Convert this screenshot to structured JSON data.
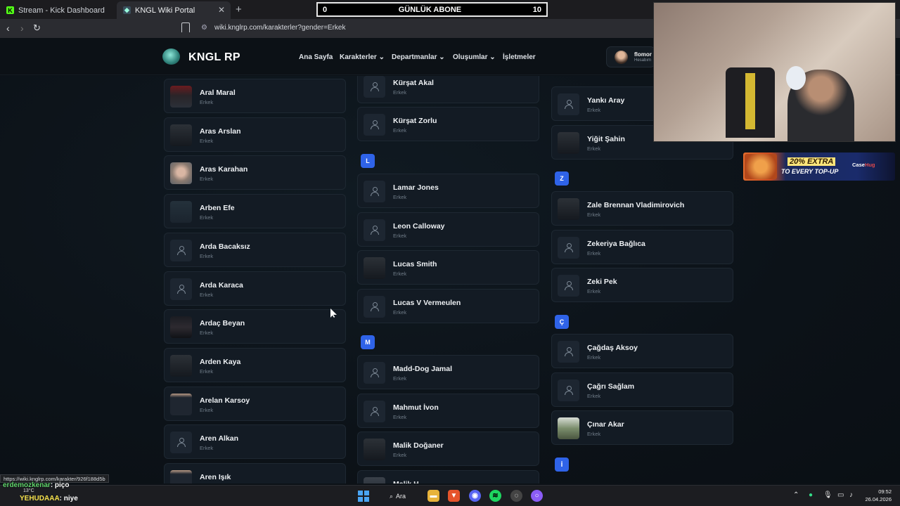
{
  "browser": {
    "tabs": [
      {
        "title": "Stream - Kick Dashboard",
        "icon": "kick-icon"
      },
      {
        "title": "KNGL Wiki Portal",
        "icon": "kngl-icon"
      }
    ],
    "url": "wiki.knglrp.com/karakterler?gender=Erkek"
  },
  "overlay": {
    "sub_label": "GÜNLÜK ABONE",
    "sub_left": "0",
    "sub_right": "10",
    "ad_title": "20% EXTRA",
    "ad_sub": "TO EVERY TOP-UP",
    "ad_brand_a": "Case",
    "ad_brand_b": "Hug"
  },
  "site": {
    "brand": "KNGL RP",
    "nav": [
      "Ana Sayfa",
      "Karakterler",
      "Departmanlar",
      "Oluşumlar",
      "İşletmeler"
    ],
    "user_name": "flomor",
    "user_sub": "Hesabım"
  },
  "gender_label": "Erkek",
  "columns": {
    "col1": [
      {
        "name": "Aral Maral",
        "avatar": "photo-red"
      },
      {
        "name": "Aras Arslan",
        "avatar": "photo-dark"
      },
      {
        "name": "Aras Karahan",
        "avatar": "photo-face"
      },
      {
        "name": "Arben Efe",
        "avatar": "photo-teal"
      },
      {
        "name": "Arda Bacaksız",
        "avatar": "default"
      },
      {
        "name": "Arda Karaca",
        "avatar": "default"
      },
      {
        "name": "Ardaç Beyan",
        "avatar": "photo-scene"
      },
      {
        "name": "Arden Kaya",
        "avatar": "photo-dark"
      },
      {
        "name": "Arelan Karsoy",
        "avatar": "photo-tan"
      },
      {
        "name": "Aren Alkan",
        "avatar": "default"
      },
      {
        "name": "Aren Işık",
        "avatar": "photo-tan"
      }
    ],
    "col2_top": [
      {
        "name": "Kürşat Akal",
        "avatar": "default"
      },
      {
        "name": "Kürşat Zorlu",
        "avatar": "default"
      }
    ],
    "col2_L_letter": "L",
    "col2_L": [
      {
        "name": "Lamar Jones",
        "avatar": "default"
      },
      {
        "name": "Leon Calloway",
        "avatar": "default"
      },
      {
        "name": "Lucas Smith",
        "avatar": "photo-dark"
      },
      {
        "name": "Lucas V Vermeulen",
        "avatar": "default"
      }
    ],
    "col2_M_letter": "M",
    "col2_M": [
      {
        "name": "Madd-Dog Jamal",
        "avatar": "default"
      },
      {
        "name": "Mahmut İvon",
        "avatar": "default"
      },
      {
        "name": "Malik Doğaner",
        "avatar": "photo-dark"
      },
      {
        "name": "Malik H...",
        "avatar": "photo-grey"
      }
    ],
    "col3_top": [
      {
        "name": "Yankı Aray",
        "avatar": "default"
      },
      {
        "name": "Yiğit Şahin",
        "avatar": "photo-dark"
      }
    ],
    "col3_Z_letter": "Z",
    "col3_Z": [
      {
        "name": "Zale Brennan Vladimirovich",
        "avatar": "photo-dark"
      },
      {
        "name": "Zekeriya Bağlıca",
        "avatar": "default"
      },
      {
        "name": "Zeki Pek",
        "avatar": "default"
      }
    ],
    "col3_C_letter": "Ç",
    "col3_C": [
      {
        "name": "Çağdaş Aksoy",
        "avatar": "default"
      },
      {
        "name": "Çağrı Sağlam",
        "avatar": "default"
      },
      {
        "name": "Çınar Akar",
        "avatar": "photo-green"
      }
    ],
    "col3_I_letter": "İ"
  },
  "status": {
    "hover_url": "https://wiki.knglrp.com/karakter/926f188d5b",
    "chat": [
      {
        "user": "erdemozkenar",
        "text": ": piço"
      },
      {
        "user": "YEHUDAAA",
        "text": ": niye"
      }
    ],
    "weather": "13°C"
  },
  "taskbar": {
    "search": "Ara",
    "time": "09:52",
    "date": "26.04.2026"
  }
}
